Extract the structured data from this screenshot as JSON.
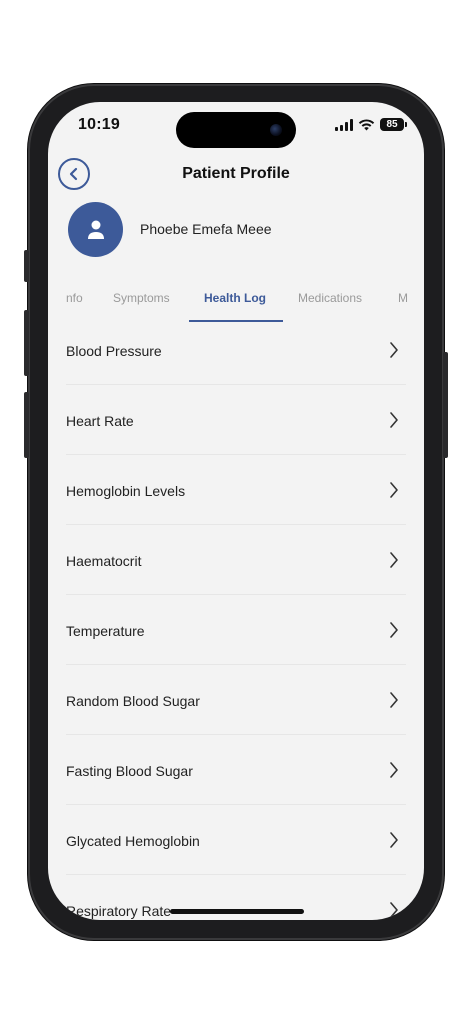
{
  "status_bar": {
    "time": "10:19",
    "battery": "85"
  },
  "header": {
    "title": "Patient Profile",
    "back_icon": "chevron-left-icon"
  },
  "profile": {
    "name": "Phoebe Emefa Meee",
    "avatar_icon": "user-icon"
  },
  "tabs": [
    {
      "label": "nfo"
    },
    {
      "label": "Symptoms"
    },
    {
      "label": "Health Log",
      "active": true
    },
    {
      "label": "Medications"
    },
    {
      "label": "M"
    }
  ],
  "health_log": {
    "items": [
      {
        "label": "Blood Pressure"
      },
      {
        "label": "Heart Rate"
      },
      {
        "label": "Hemoglobin Levels"
      },
      {
        "label": "Haematocrit"
      },
      {
        "label": "Temperature"
      },
      {
        "label": "Random Blood Sugar"
      },
      {
        "label": "Fasting Blood Sugar"
      },
      {
        "label": "Glycated Hemoglobin"
      },
      {
        "label": "Respiratory Rate"
      }
    ]
  },
  "colors": {
    "accent": "#3d5a99",
    "background": "#f3f3f3"
  }
}
